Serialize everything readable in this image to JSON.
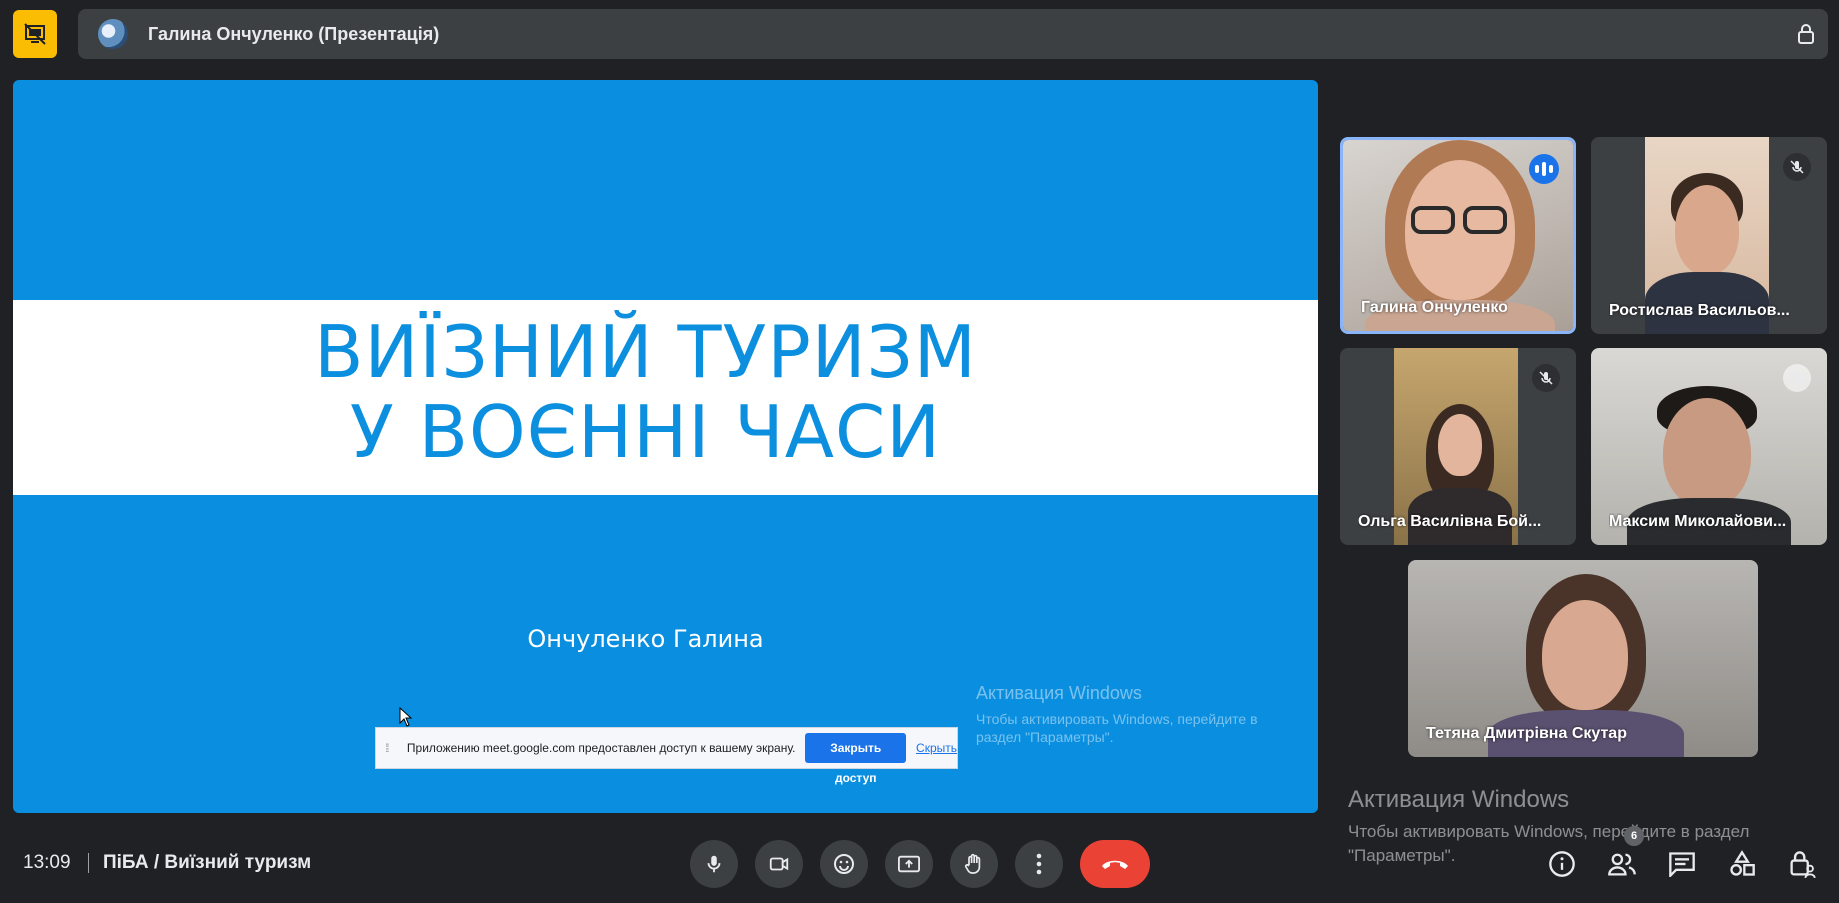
{
  "header": {
    "presenter_title": "Галина Ончуленко (Презентація)"
  },
  "slide": {
    "title_line1": "ВИЇЗНИЙ ТУРИЗМ",
    "title_line2": "У ВОЄННІ ЧАСИ",
    "author": "Ончуленко Галина"
  },
  "share_banner": {
    "text": "Приложению meet.google.com предоставлен доступ к вашему экрану.",
    "stop_label": "Закрыть доступ",
    "hide_label": "Скрыть"
  },
  "watermark": {
    "title": "Активация Windows",
    "subtitle": "Чтобы активировать Windows, перейдите в раздел \"Параметры\"."
  },
  "participants": [
    {
      "name": "Галина Ончуленко",
      "speaking": true,
      "muted": false
    },
    {
      "name": "Ростислав Васильов...",
      "speaking": false,
      "muted": true
    },
    {
      "name": "Ольга Василівна Бой...",
      "speaking": false,
      "muted": true
    },
    {
      "name": "Максим Миколайови...",
      "speaking": false,
      "muted": true
    },
    {
      "name": "Тетяна Дмитрівна Скутар",
      "speaking": false,
      "muted": false
    }
  ],
  "footer": {
    "time": "13:09",
    "meeting_name": "ПіБА / Виїзний туризм",
    "participant_count": "6"
  },
  "colors": {
    "slide_blue": "#0a8fe0",
    "end_call": "#ea4335",
    "accent": "#1a73e8",
    "top_icon": "#fbbc04"
  }
}
